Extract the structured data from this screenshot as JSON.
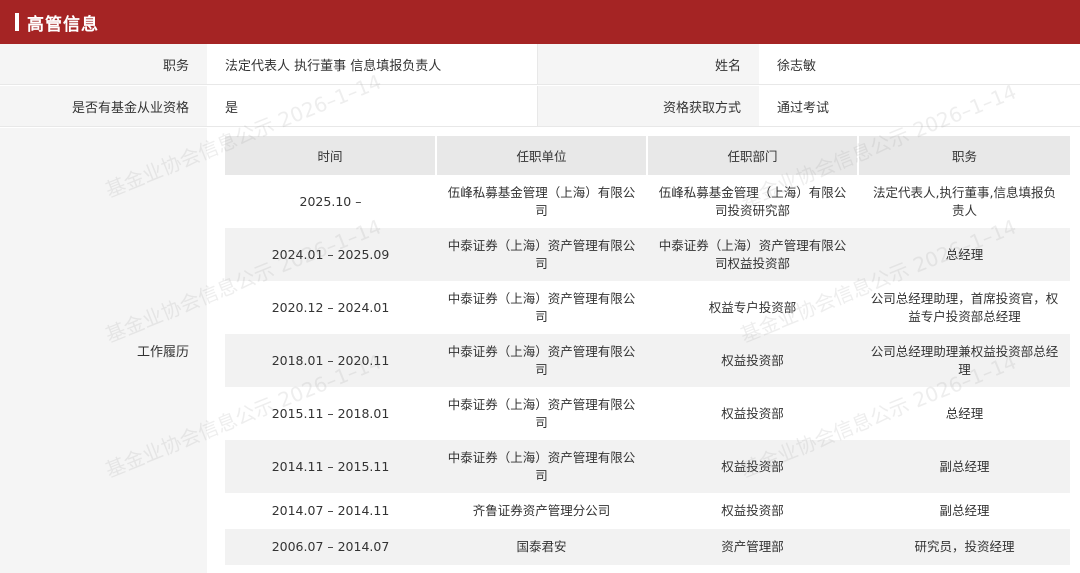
{
  "header": {
    "title": "高管信息"
  },
  "info": {
    "row1": {
      "label_a": "职务",
      "value_a": "法定代表人 执行董事 信息填报负责人",
      "label_b": "姓名",
      "value_b": "徐志敏"
    },
    "row2": {
      "label_a": "是否有基金从业资格",
      "value_a": "是",
      "label_b": "资格获取方式",
      "value_b": "通过考试"
    }
  },
  "work": {
    "label": "工作履历",
    "columns": [
      "时间",
      "任职单位",
      "任职部门",
      "职务"
    ],
    "rows": [
      {
        "time": "2025.10 –",
        "unit": "伍峰私募基金管理（上海）有限公司",
        "dept": "伍峰私募基金管理（上海）有限公司投资研究部",
        "role": "法定代表人,执行董事,信息填报负责人"
      },
      {
        "time": "2024.01 – 2025.09",
        "unit": "中泰证券（上海）资产管理有限公司",
        "dept": "中泰证券（上海）资产管理有限公司权益投资部",
        "role": "总经理"
      },
      {
        "time": "2020.12 – 2024.01",
        "unit": "中泰证券（上海）资产管理有限公司",
        "dept": "权益专户投资部",
        "role": "公司总经理助理，首席投资官，权益专户投资部总经理"
      },
      {
        "time": "2018.01 – 2020.11",
        "unit": "中泰证券（上海）资产管理有限公司",
        "dept": "权益投资部",
        "role": "公司总经理助理兼权益投资部总经理"
      },
      {
        "time": "2015.11 – 2018.01",
        "unit": "中泰证券（上海）资产管理有限公司",
        "dept": "权益投资部",
        "role": "总经理"
      },
      {
        "time": "2014.11 – 2015.11",
        "unit": "中泰证券（上海）资产管理有限公司",
        "dept": "权益投资部",
        "role": "副总经理"
      },
      {
        "time": "2014.07 – 2014.11",
        "unit": "齐鲁证券资产管理分公司",
        "dept": "权益投资部",
        "role": "副总经理"
      },
      {
        "time": "2006.07 – 2014.07",
        "unit": "国泰君安",
        "dept": "资产管理部",
        "role": "研究员，投资经理"
      }
    ]
  },
  "watermark": {
    "text": "基金业协会信息公示 2026–1–14"
  }
}
